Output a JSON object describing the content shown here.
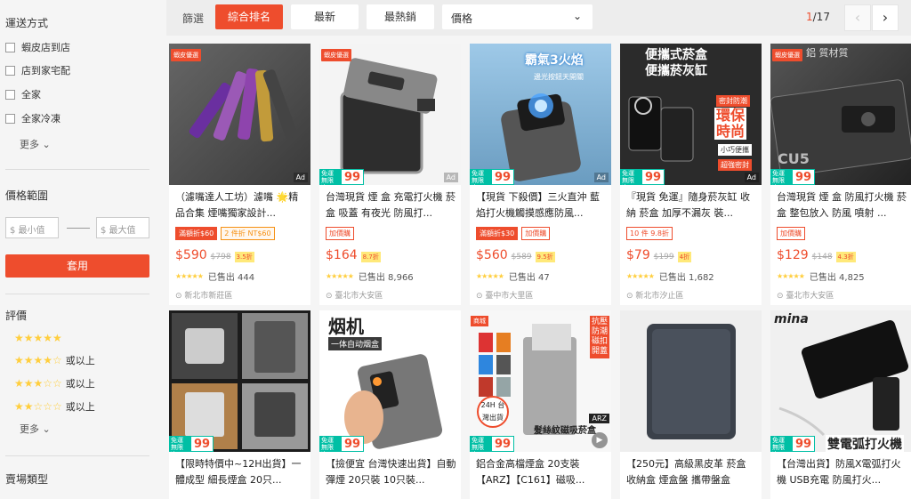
{
  "sidebar": {
    "shipping": {
      "title": "運送方式",
      "options": [
        "蝦皮店到店",
        "店到家宅配",
        "全家",
        "全家冷凍"
      ],
      "more": "更多"
    },
    "price": {
      "title": "價格範圍",
      "min_placeholder": "$ 最小值",
      "max_placeholder": "$ 最大值",
      "apply": "套用"
    },
    "rating": {
      "title": "評價",
      "rows": [
        {
          "stars": 5,
          "label": ""
        },
        {
          "stars": 4,
          "label": "或以上"
        },
        {
          "stars": 3,
          "label": "或以上"
        },
        {
          "stars": 2,
          "label": "或以上"
        }
      ],
      "more": "更多"
    },
    "seller_type": {
      "title": "賣場類型"
    }
  },
  "sort": {
    "label": "篩選",
    "buttons": [
      "綜合排名",
      "最新",
      "最熱銷"
    ],
    "price_select": "價格",
    "page_current": "1",
    "page_total": "/17"
  },
  "colors": {
    "accent": "#ee4d2d",
    "freeship": "#00bfa5",
    "star": "#ffce3d"
  },
  "products": [
    {
      "pref": "蝦皮優選",
      "ad": "Ad",
      "freeship": false,
      "title": "（濾嘴達人工坊）濾嘴 🌟精品合集 煙嘴獨家設計...",
      "tags": [
        {
          "t": "滿額折$60",
          "s": "fill"
        },
        {
          "t": "2 件折 NT$60",
          "s": ""
        }
      ],
      "price": "$590",
      "old": "$798",
      "disc": "3.5折",
      "sold": "已售出 444",
      "loc": "新北市新莊區"
    },
    {
      "pref": "蝦皮優選",
      "ad": "Ad",
      "freeship": true,
      "title": "台灣現貨 煙 盒 充電打火機 菸盒 吸蓋 有夜光 防風打...",
      "tags": [
        {
          "t": "加價購",
          "s": ""
        }
      ],
      "price": "$164",
      "old": "",
      "disc": "8.7折",
      "sold": "已售出 8,966",
      "loc": "臺北市大安區"
    },
    {
      "pref": "",
      "ad": "Ad",
      "freeship": true,
      "title": "【現貨 下殺價】三火直沖 藍焰打火機觸摸感應防風...",
      "tags": [
        {
          "t": "滿額折$30",
          "s": "fill"
        },
        {
          "t": "加價購",
          "s": ""
        }
      ],
      "price": "$560",
      "old": "$589",
      "disc": "9.5折",
      "sold": "已售出 47",
      "loc": "臺中市大里區"
    },
    {
      "pref": "",
      "ad": "Ad",
      "freeship": true,
      "title": "『現貨 免運』隨身菸灰缸 收納 菸盒 加厚不漏灰 裝...",
      "tags": [
        {
          "t": "10 件 9.8折",
          "s": ""
        }
      ],
      "price": "$79",
      "old": "$199",
      "disc": "4折",
      "sold": "已售出 1,682",
      "loc": "新北市汐止區"
    },
    {
      "pref": "蝦皮優選",
      "ad": "",
      "freeship": true,
      "title": "台灣現貨 煙 盒 防風打火機 菸盒 整包放入 防風 噴射 ...",
      "tags": [
        {
          "t": "加價購",
          "s": ""
        }
      ],
      "price": "$129",
      "old": "$148",
      "disc": "4.3折",
      "sold": "已售出 4,825",
      "loc": "臺北市大安區"
    },
    {
      "pref": "",
      "freeship": true,
      "title": "【限時特價中~12H出貨】一體成型 細長煙盒 20只..."
    },
    {
      "pref": "",
      "freeship": true,
      "title": "【撿便宜 台灣快速出貨】自動彈煙 20只裝 10只裝..."
    },
    {
      "pref": "商城",
      "freeship": true,
      "title": "鋁合金高檔煙盒 20支裝 【ARZ】【C161】磁吸..."
    },
    {
      "pref": "",
      "freeship": false,
      "title": "【250元】高級黑皮革 菸盒 收納盒 煙盒盤 攜帶盤盒"
    },
    {
      "pref": "",
      "freeship": true,
      "title": "【台灣出貨】防風X電弧打火機 USB充電 防風打火..."
    }
  ],
  "image_text": {
    "p3_top": "霸氣3火焰",
    "p3_sub": "邊光按鈕天開關",
    "p4_l1": "便攜式菸盒",
    "p4_l2": "便攜菸灰缸",
    "p4_l3": "環保",
    "p4_l4": "時尚",
    "p4_b1": "密封防潮",
    "p4_b2": "小巧便攜",
    "p4_b3": "超強密封",
    "p5_t": "鋁 質材質",
    "p5_s": "CU5",
    "p7_t": "烟机",
    "p7_s": "一体自动烟盒",
    "p8_side": "抗壓防潮磁扣開蓋",
    "p8_badge": "24H 台灣出貨",
    "p8_foot": "髮絲紋磁吸菸盒",
    "p8_arz": "ARZ",
    "p10_t": "mina",
    "p10_b": "雙電弧打火機",
    "free_a": "免運 無限次",
    "free_b": "99"
  }
}
